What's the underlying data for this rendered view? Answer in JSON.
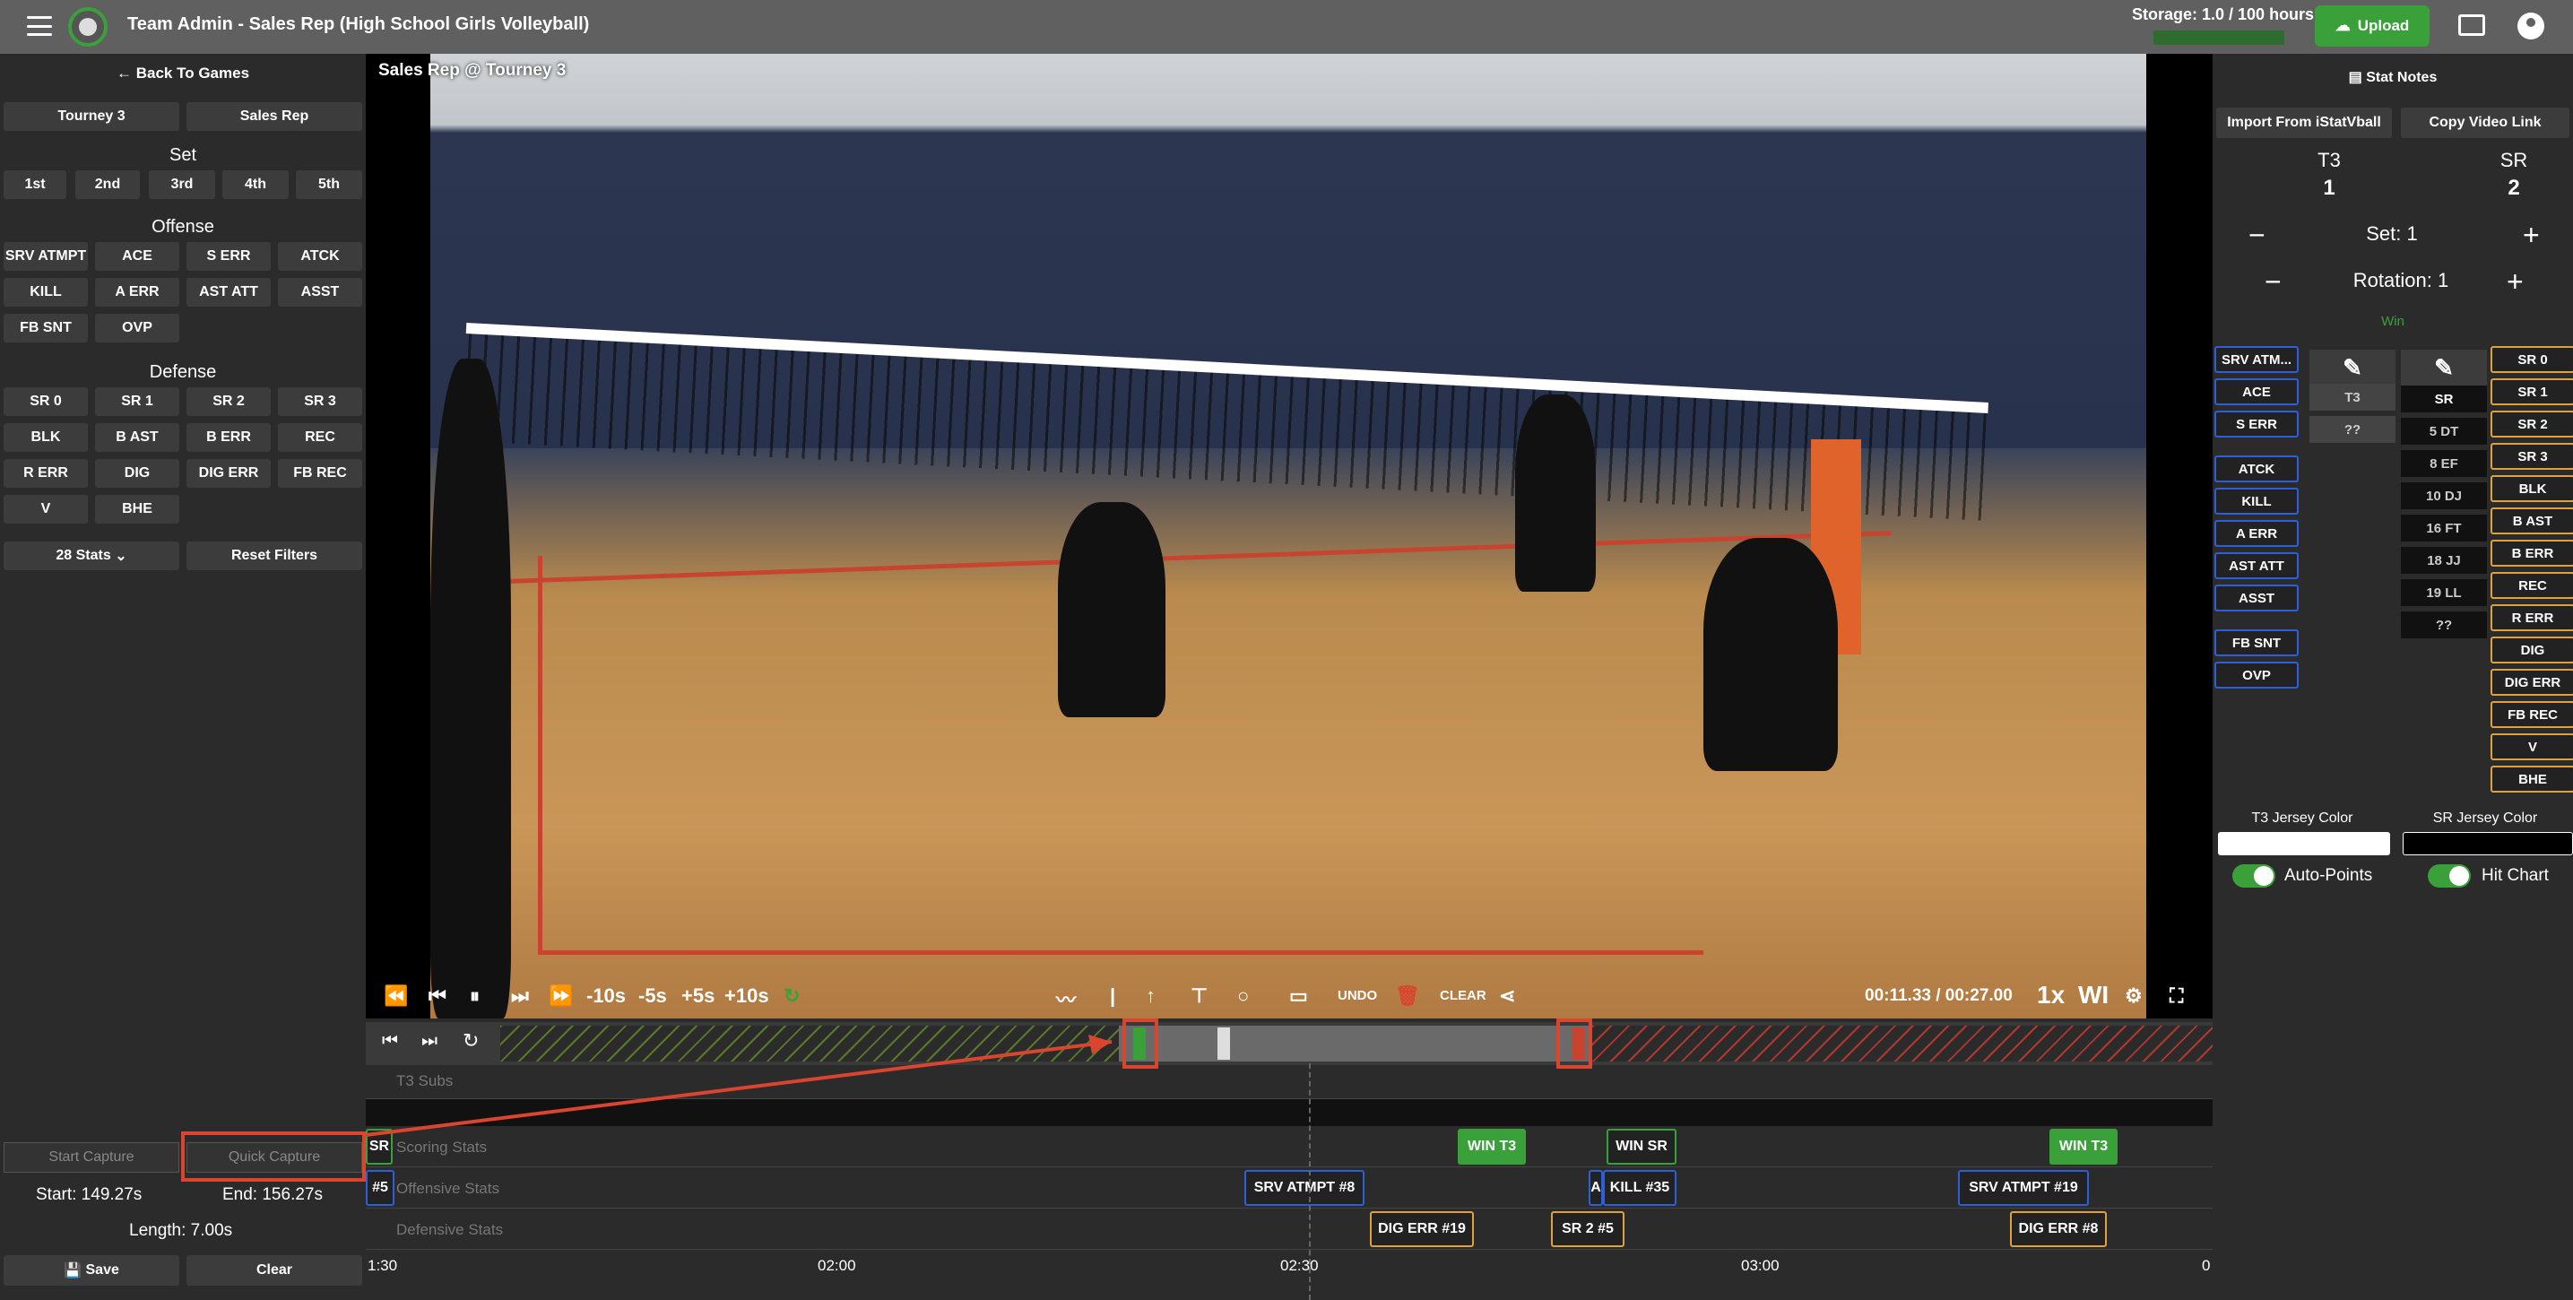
{
  "header": {
    "title": "Team Admin - Sales Rep (High School Girls Volleyball)",
    "storage": "Storage: 1.0 / 100 hours",
    "storage_used": 0.01,
    "upload_label": "Upload"
  },
  "left": {
    "back_label": "Back To Games",
    "team_a": "Tourney 3",
    "team_b": "Sales Rep",
    "set_heading": "Set",
    "sets": [
      "1st",
      "2nd",
      "3rd",
      "4th",
      "5th"
    ],
    "offense_heading": "Offense",
    "offense": [
      "SRV ATMPT",
      "ACE",
      "S ERR",
      "ATCK",
      "KILL",
      "A ERR",
      "AST ATT",
      "ASST",
      "FB SNT",
      "OVP"
    ],
    "defense_heading": "Defense",
    "defense": [
      "SR 0",
      "SR 1",
      "SR 2",
      "SR 3",
      "BLK",
      "B AST",
      "B ERR",
      "REC",
      "R ERR",
      "DIG",
      "DIG ERR",
      "FB REC",
      "V",
      "BHE"
    ],
    "stats_dropdown": "28 Stats",
    "reset_label": "Reset Filters",
    "start_capture": "Start Capture",
    "quick_capture": "Quick Capture",
    "start": "Start: 149.27s",
    "end": "End: 156.27s",
    "length": "Length: 7.00s",
    "save": "Save",
    "clear": "Clear"
  },
  "video": {
    "title": "Sales Rep @ Tourney 3",
    "skip": [
      "-10s",
      "-5s",
      "+5s",
      "+10s"
    ],
    "undo": "UNDO",
    "clear": "CLEAR",
    "time": "00:11.33 / 00:27.00",
    "speed": "1x",
    "wi": "WI"
  },
  "timeline": {
    "subs_label": "T3 Subs",
    "scoring_label": "Scoring Stats",
    "offensive_label": "Offensive Stats",
    "defensive_label": "Defensive Stats",
    "left_chip_scoring": "SR",
    "left_chip_offense": "#5",
    "scoring": [
      "WIN T3",
      "WIN SR",
      "WIN T3"
    ],
    "offensive": [
      "SRV ATMPT #8",
      "A",
      "KILL #35",
      "SRV ATMPT #19"
    ],
    "defensive": [
      "DIG ERR #19",
      "SR 2 #5",
      "DIG ERR #8"
    ],
    "axis": [
      "1:30",
      "02:00",
      "02:30",
      "03:00",
      "0"
    ]
  },
  "right": {
    "stat_notes": "Stat Notes",
    "import": "Import From iStatVball",
    "copy_link": "Copy Video Link",
    "team_a": "T3",
    "team_b": "SR",
    "score_a": "1",
    "score_b": "2",
    "set": "Set: 1",
    "rotation": "Rotation: 1",
    "win": "Win",
    "team_stats": [
      "SRV ATM...",
      "ACE",
      "S ERR",
      "ATCK",
      "KILL",
      "A ERR",
      "AST ATT",
      "ASST",
      "FB SNT",
      "OVP"
    ],
    "t3_players": [
      "T3",
      "??"
    ],
    "sr_players": [
      "SR",
      "5 DT",
      "8 EF",
      "10 DJ",
      "16 FT",
      "18 JJ",
      "19 LL",
      "??"
    ],
    "opp_stats": [
      "SR 0",
      "SR 1",
      "SR 2",
      "SR 3",
      "BLK",
      "B AST",
      "B ERR",
      "REC",
      "R ERR",
      "DIG",
      "DIG ERR",
      "FB REC",
      "V",
      "BHE"
    ],
    "t3_jersey": "T3 Jersey Color",
    "sr_jersey": "SR Jersey Color",
    "auto_points": "Auto-Points",
    "hit_chart": "Hit Chart"
  }
}
